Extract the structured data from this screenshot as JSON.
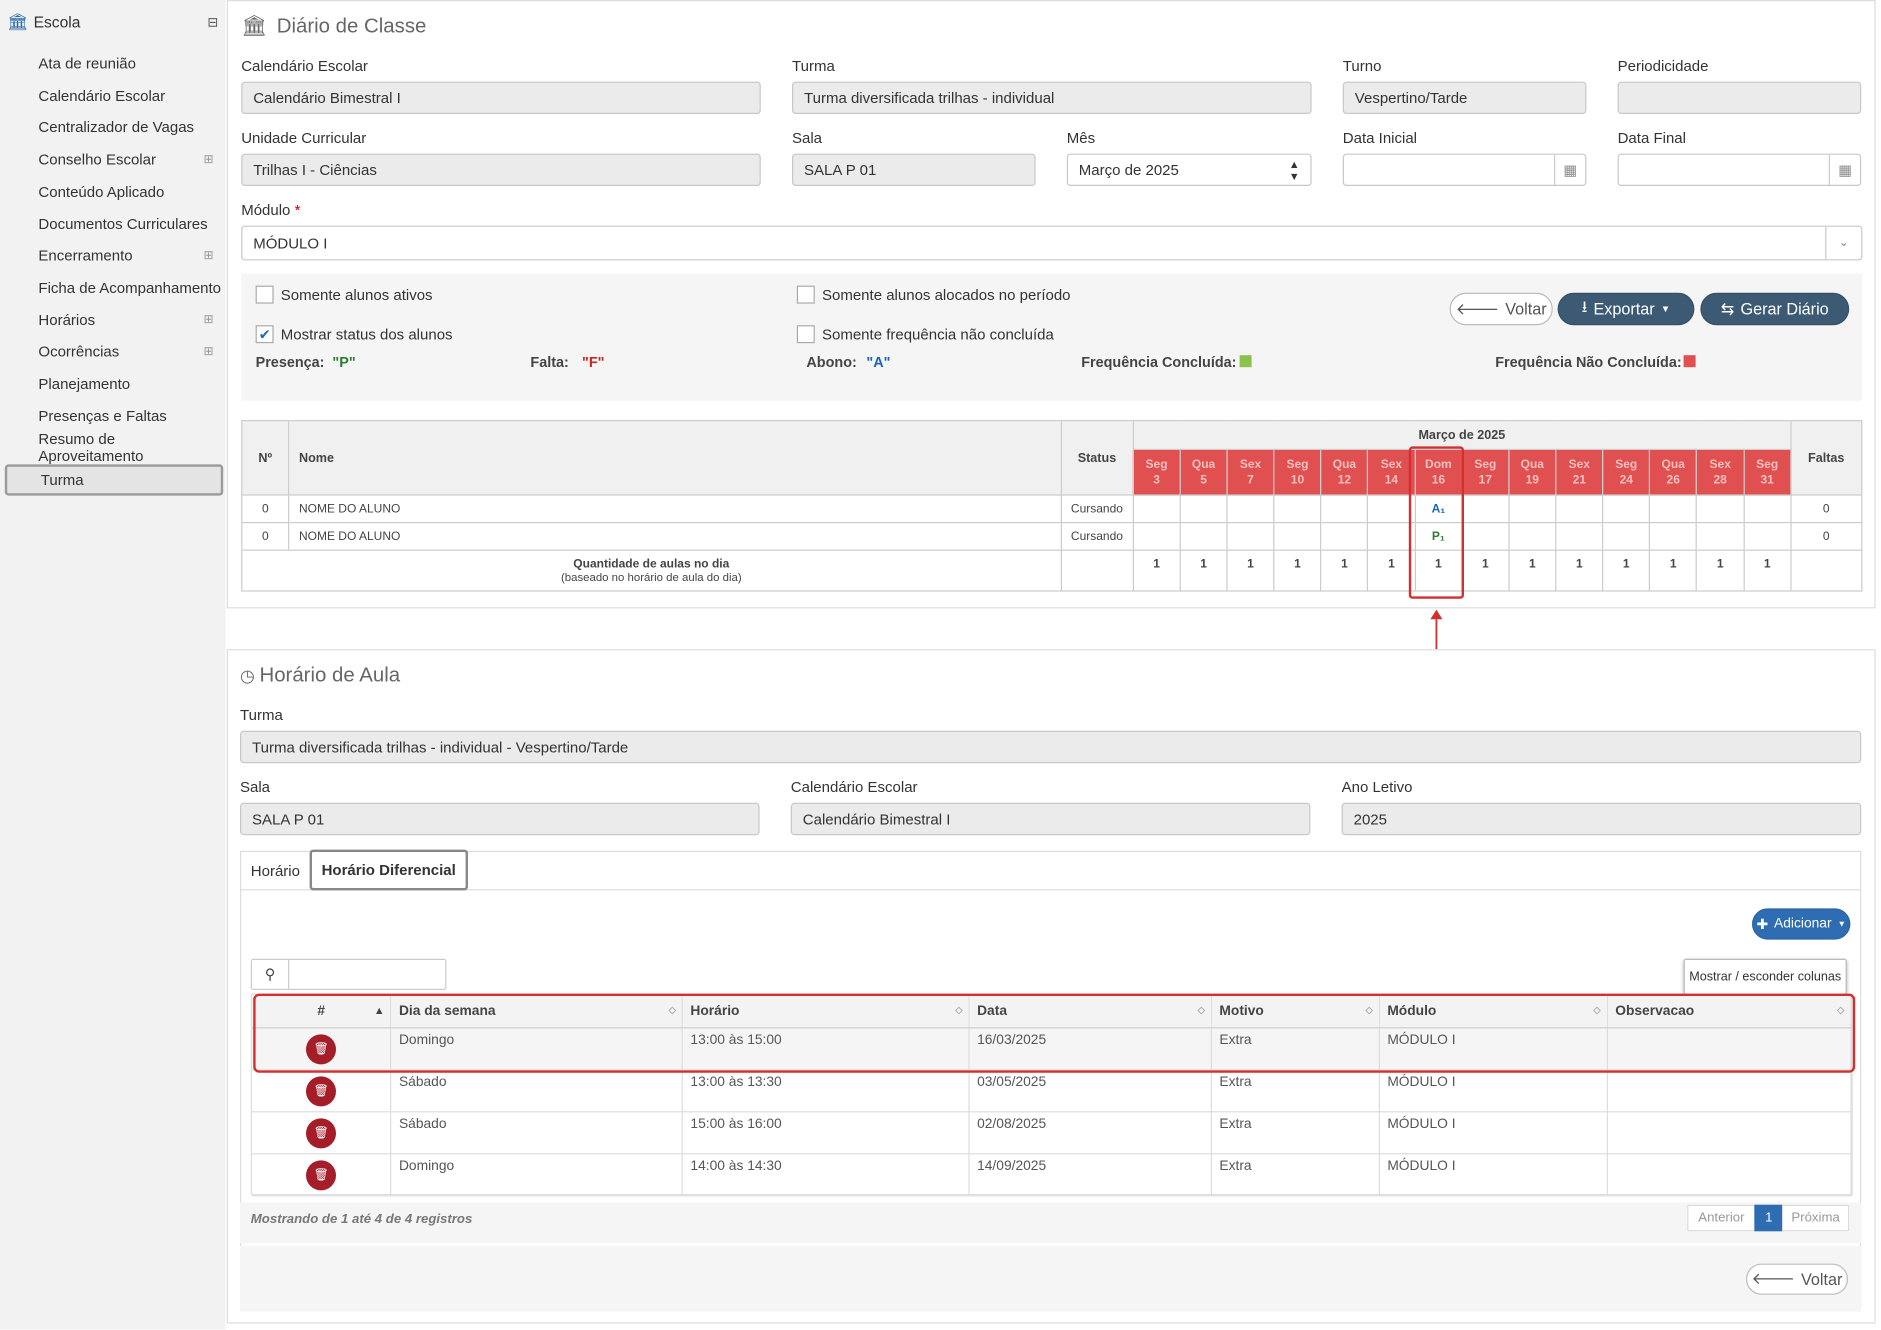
{
  "sidebar": {
    "title": "Escola",
    "items": [
      {
        "label": "Ata de reunião",
        "plus": ""
      },
      {
        "label": "Calendário Escolar",
        "plus": ""
      },
      {
        "label": "Centralizador de Vagas",
        "plus": ""
      },
      {
        "label": "Conselho Escolar",
        "plus": "⊞"
      },
      {
        "label": "Conteúdo Aplicado",
        "plus": ""
      },
      {
        "label": "Documentos Curriculares",
        "plus": ""
      },
      {
        "label": "Encerramento",
        "plus": "⊞"
      },
      {
        "label": "Ficha de Acompanhamento",
        "plus": ""
      },
      {
        "label": "Horários",
        "plus": "⊞"
      },
      {
        "label": "Ocorrências",
        "plus": "⊞"
      },
      {
        "label": "Planejamento",
        "plus": ""
      },
      {
        "label": "Presenças e Faltas",
        "plus": ""
      },
      {
        "label": "Resumo de Aproveitamento",
        "plus": ""
      },
      {
        "label": "Turma",
        "plus": ""
      }
    ]
  },
  "diario": {
    "title": "Diário de Classe",
    "calendario": {
      "label": "Calendário Escolar",
      "value": "Calendário Bimestral I"
    },
    "turma": {
      "label": "Turma",
      "value": "Turma diversificada trilhas - individual"
    },
    "turno": {
      "label": "Turno",
      "value": "Vespertino/Tarde"
    },
    "periodicidade": {
      "label": "Periodicidade",
      "value": ""
    },
    "unidade": {
      "label": "Unidade Curricular",
      "value": "Trilhas I - Ciências"
    },
    "sala": {
      "label": "Sala",
      "value": "SALA P 01"
    },
    "mes": {
      "label": "Mês",
      "value": "Março de 2025"
    },
    "data_inicial": {
      "label": "Data Inicial",
      "value": ""
    },
    "data_final": {
      "label": "Data Final",
      "value": ""
    },
    "modulo": {
      "label": "Módulo",
      "required": "*",
      "value": "MÓDULO I"
    },
    "chk_ativos": "Somente alunos ativos",
    "chk_status": "Mostrar status dos alunos",
    "chk_alocados": "Somente alunos alocados no período",
    "chk_freq": "Somente frequência não concluída",
    "legend": {
      "presenca": "Presença:",
      "presenca_v": "\"P\"",
      "falta": "Falta:",
      "falta_v": "\"F\"",
      "abono": "Abono:",
      "abono_v": "\"A\"",
      "conc": "Frequência Concluída:",
      "nconc": "Frequência Não Concluída:"
    },
    "buttons": {
      "voltar": "Voltar",
      "exportar": "Exportar",
      "gerar": "Gerar Diário"
    },
    "grid": {
      "h_num": "Nº",
      "h_nome": "Nome",
      "h_status": "Status",
      "h_month": "Março de 2025",
      "h_faltas": "Faltas",
      "days": [
        {
          "w": "Seg",
          "d": "3"
        },
        {
          "w": "Qua",
          "d": "5"
        },
        {
          "w": "Sex",
          "d": "7"
        },
        {
          "w": "Seg",
          "d": "10"
        },
        {
          "w": "Qua",
          "d": "12"
        },
        {
          "w": "Sex",
          "d": "14"
        },
        {
          "w": "Dom",
          "d": "16"
        },
        {
          "w": "Seg",
          "d": "17"
        },
        {
          "w": "Qua",
          "d": "19"
        },
        {
          "w": "Sex",
          "d": "21"
        },
        {
          "w": "Seg",
          "d": "24"
        },
        {
          "w": "Qua",
          "d": "26"
        },
        {
          "w": "Sex",
          "d": "28"
        },
        {
          "w": "Seg",
          "d": "31"
        }
      ],
      "rows": [
        {
          "num": "0",
          "nome": "NOME DO ALUNO",
          "status": "Cursando",
          "mark": "A₁",
          "faltas": "0"
        },
        {
          "num": "0",
          "nome": "NOME DO ALUNO",
          "status": "Cursando",
          "mark": "P₁",
          "faltas": "0"
        }
      ],
      "qty_label": "Quantidade de aulas no dia",
      "qty_sub": "(baseado no horário de aula do dia)",
      "qty": [
        "1",
        "1",
        "1",
        "1",
        "1",
        "1",
        "1",
        "1",
        "1",
        "1",
        "1",
        "1",
        "1",
        "1"
      ]
    }
  },
  "horario": {
    "title": "Horário de Aula",
    "turma": {
      "label": "Turma",
      "value": "Turma diversificada trilhas - individual - Vespertino/Tarde"
    },
    "sala": {
      "label": "Sala",
      "value": "SALA P 01"
    },
    "calendario": {
      "label": "Calendário Escolar",
      "value": "Calendário Bimestral I"
    },
    "ano": {
      "label": "Ano Letivo",
      "value": "2025"
    },
    "tabs": [
      "Horário",
      "Horário Diferencial"
    ],
    "adicionar": "Adicionar",
    "mostrar": "Mostrar / esconder colunas",
    "search_value": "",
    "cols": [
      "#",
      "Dia da semana",
      "Horário",
      "Data",
      "Motivo",
      "Módulo",
      "Observacao"
    ],
    "rows": [
      {
        "dia": "Domingo",
        "hora": "13:00 às 15:00",
        "data": "16/03/2025",
        "motivo": "Extra",
        "modulo": "MÓDULO I",
        "obs": ""
      },
      {
        "dia": "Sábado",
        "hora": "13:00 às 13:30",
        "data": "03/05/2025",
        "motivo": "Extra",
        "modulo": "MÓDULO I",
        "obs": ""
      },
      {
        "dia": "Sábado",
        "hora": "15:00 às 16:00",
        "data": "02/08/2025",
        "motivo": "Extra",
        "modulo": "MÓDULO I",
        "obs": ""
      },
      {
        "dia": "Domingo",
        "hora": "14:00 às 14:30",
        "data": "14/09/2025",
        "motivo": "Extra",
        "modulo": "MÓDULO I",
        "obs": ""
      }
    ],
    "info": "Mostrando de 1 até 4 de 4 registros",
    "pag": {
      "prev": "Anterior",
      "page": "1",
      "next": "Próxima"
    },
    "voltar": "Voltar"
  },
  "colors": {
    "accent": "#2f6db3",
    "day_header": "#e05050",
    "highlight": "#d32f2f",
    "done": "#8bc34a",
    "not_done": "#e05050"
  }
}
